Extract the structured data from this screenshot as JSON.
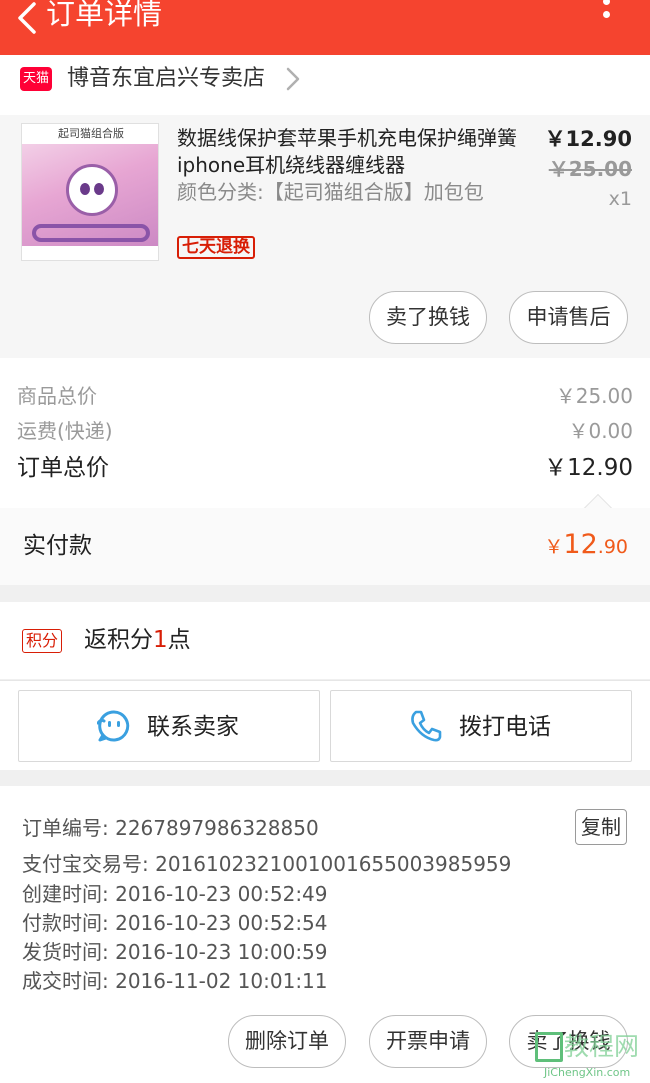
{
  "header": {
    "title": "订单详情",
    "back_icon": "chevron-left-icon",
    "more_icon": "more-vertical-icon"
  },
  "shop": {
    "badge": "天猫",
    "name": "博音东宜启兴专卖店"
  },
  "item": {
    "image_caption": "起司猫组合版",
    "title": "数据线保护套苹果手机充电保护绳弹簧iphone耳机绕线器缠线器",
    "sku": "颜色分类:【起司猫组合版】加包包",
    "return_tag": "七天退换",
    "price": "￥12.90",
    "original_price": "￥25.00",
    "quantity": "x1",
    "buttons": [
      "卖了换钱",
      "申请售后"
    ]
  },
  "summary": {
    "goods_label": "商品总价",
    "goods_value": "￥25.00",
    "shipping_label": "运费(快递)",
    "shipping_value": "￥0.00",
    "total_label": "订单总价",
    "total_value": "￥12.90"
  },
  "paid": {
    "label": "实付款",
    "currency": "￥",
    "integer": "12",
    "decimal": ".90"
  },
  "points": {
    "badge": "积分",
    "prefix": "返积分",
    "number": "1",
    "suffix": "点"
  },
  "actions": {
    "contact_seller": "联系卖家",
    "call": "拨打电话"
  },
  "order_info": {
    "order_no": "订单编号: 2267897986328850",
    "copy": "复制",
    "alipay_no": "支付宝交易号: 2016102321001001655003985959",
    "created": "创建时间: 2016-10-23 00:52:49",
    "paid_time": "付款时间: 2016-10-23 00:52:54",
    "shipped": "发货时间: 2016-10-23 10:00:59",
    "completed": "成交时间: 2016-11-02 10:01:11"
  },
  "bottom_buttons": [
    "删除订单",
    "开票申请",
    "卖了换钱"
  ],
  "watermark": {
    "text": "教程网",
    "url": "JiChengXin.com"
  },
  "colors": {
    "header": "#f5442f",
    "accent_red": "#d81e06",
    "paid_orange": "#f05a1a",
    "icon_blue": "#3aa0e0"
  }
}
